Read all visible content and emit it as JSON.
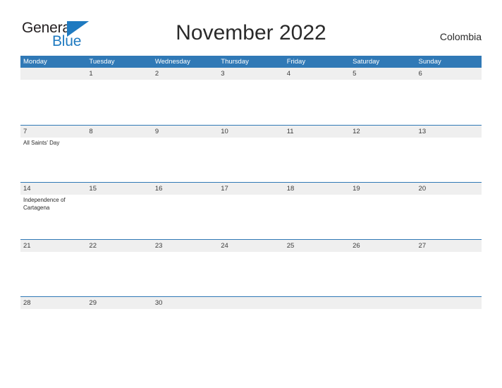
{
  "brand": {
    "name_part1": "General",
    "name_part2": "Blue",
    "flag_icon": "flag-triangle-icon",
    "accent_color": "#1f7ac0"
  },
  "header": {
    "title": "November 2022",
    "country": "Colombia"
  },
  "theme": {
    "header_blue": "#3079b6",
    "date_band_gray": "#efefef",
    "divider_blue": "#3079b6",
    "text_dark": "#2a2a2a"
  },
  "calendar": {
    "month": "November",
    "year": "2022",
    "weekday_headers": [
      "Monday",
      "Tuesday",
      "Wednesday",
      "Thursday",
      "Friday",
      "Saturday",
      "Sunday"
    ],
    "weeks": [
      [
        {
          "date": "",
          "events": []
        },
        {
          "date": "1",
          "events": []
        },
        {
          "date": "2",
          "events": []
        },
        {
          "date": "3",
          "events": []
        },
        {
          "date": "4",
          "events": []
        },
        {
          "date": "5",
          "events": []
        },
        {
          "date": "6",
          "events": []
        }
      ],
      [
        {
          "date": "7",
          "events": [
            "All Saints' Day"
          ]
        },
        {
          "date": "8",
          "events": []
        },
        {
          "date": "9",
          "events": []
        },
        {
          "date": "10",
          "events": []
        },
        {
          "date": "11",
          "events": []
        },
        {
          "date": "12",
          "events": []
        },
        {
          "date": "13",
          "events": []
        }
      ],
      [
        {
          "date": "14",
          "events": [
            "Independence of Cartagena"
          ]
        },
        {
          "date": "15",
          "events": []
        },
        {
          "date": "16",
          "events": []
        },
        {
          "date": "17",
          "events": []
        },
        {
          "date": "18",
          "events": []
        },
        {
          "date": "19",
          "events": []
        },
        {
          "date": "20",
          "events": []
        }
      ],
      [
        {
          "date": "21",
          "events": []
        },
        {
          "date": "22",
          "events": []
        },
        {
          "date": "23",
          "events": []
        },
        {
          "date": "24",
          "events": []
        },
        {
          "date": "25",
          "events": []
        },
        {
          "date": "26",
          "events": []
        },
        {
          "date": "27",
          "events": []
        }
      ],
      [
        {
          "date": "28",
          "events": []
        },
        {
          "date": "29",
          "events": []
        },
        {
          "date": "30",
          "events": []
        },
        {
          "date": "",
          "events": []
        },
        {
          "date": "",
          "events": []
        },
        {
          "date": "",
          "events": []
        },
        {
          "date": "",
          "events": []
        }
      ]
    ]
  }
}
